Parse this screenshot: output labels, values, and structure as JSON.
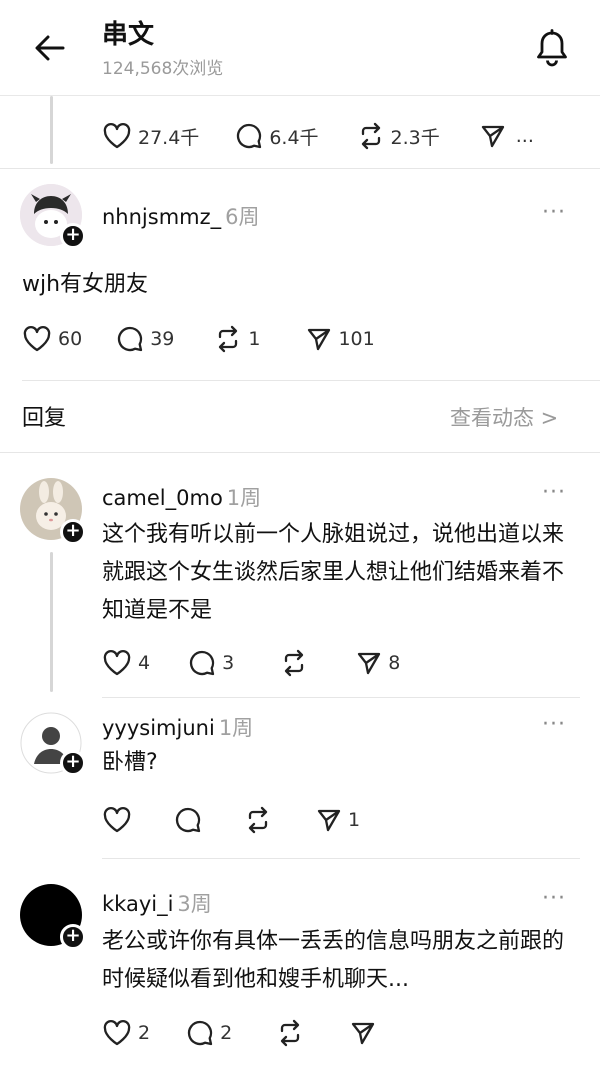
{
  "header": {
    "title": "串文",
    "views": "124,568次浏览",
    "back_icon": "arrow-left-icon",
    "bell_icon": "bell-icon"
  },
  "top_actions": {
    "likes": "27.4千",
    "comments": "6.4千",
    "reposts": "2.3千",
    "more": "..."
  },
  "main_post": {
    "username": "nhnjsmmz_",
    "time": "6周",
    "text": "wjh有女朋友",
    "likes": "60",
    "comments": "39",
    "reposts": "1",
    "shares": "101"
  },
  "replies_header": {
    "title": "回复",
    "view_activity": "查看动态 >"
  },
  "replies": [
    {
      "username": "camel_0mo",
      "time": "1周",
      "text": "这个我有听以前一个人脉姐说过，说他出道以来就跟这个女生谈然后家里人想让他们结婚来着不知道是不是",
      "likes": "4",
      "comments": "3",
      "reposts": "",
      "shares": "8"
    },
    {
      "username": "yyysimjuni",
      "time": "1周",
      "text": "卧槽?",
      "likes": "",
      "comments": "",
      "reposts": "",
      "shares": "1"
    },
    {
      "username": "kkayi_i",
      "time": "3周",
      "text": "老公或许你有具体一丢丢的信息吗朋友之前跟的时候疑似看到他和嫂手机聊天...",
      "likes": "2",
      "comments": "2",
      "reposts": "",
      "shares": ""
    }
  ]
}
